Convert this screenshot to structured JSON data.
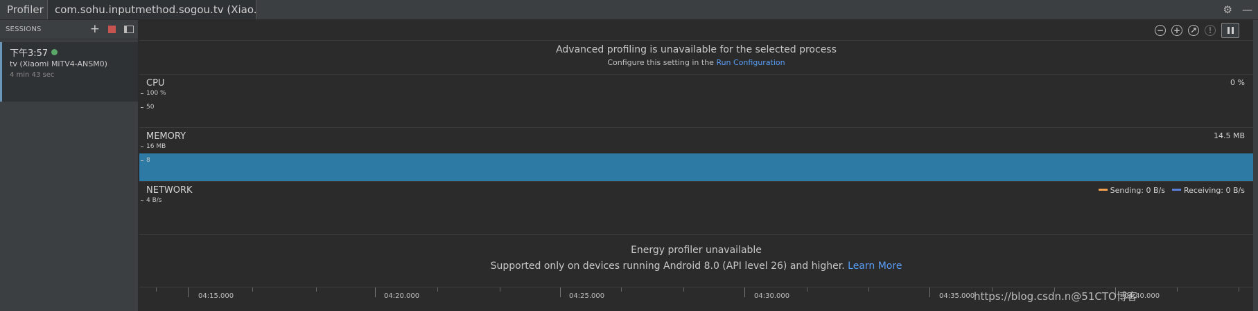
{
  "window": {
    "title": "Profiler",
    "process_tab": "com.sohu.inputmethod.sogou.tv (Xiao..."
  },
  "sidebar": {
    "sessions_label": "SESSIONS",
    "session": {
      "time": "下午3:57",
      "device": "tv (Xiaomi MiTV4-ANSM0)",
      "duration": "4 min 43 sec",
      "status_color": "#59a869"
    }
  },
  "notice": {
    "title": "Advanced profiling is unavailable for the selected process",
    "sub_prefix": "Configure this setting in the",
    "sub_link": "Run Configuration"
  },
  "cpu": {
    "title": "CPU",
    "value": "0 %",
    "ticks": [
      "100 %",
      "50"
    ]
  },
  "memory": {
    "title": "MEMORY",
    "value": "14.5 MB",
    "ticks": [
      "16 MB",
      "8"
    ],
    "fill_color": "#2d7aa4"
  },
  "network": {
    "title": "NETWORK",
    "tick": "4 B/s",
    "sending": "Sending: 0 B/s",
    "receiving": "Receiving: 0 B/s",
    "sending_color": "#f0a050",
    "receiving_color": "#5a7fd8"
  },
  "energy": {
    "title": "Energy profiler unavailable",
    "sub": "Supported only on devices running Android 8.0 (API level 26) and higher.",
    "link": "Learn More"
  },
  "timeline": {
    "labels": [
      "04:15.000",
      "04:20.000",
      "04:25.000",
      "04:30.000",
      "04:35.000",
      "04:40.000"
    ]
  },
  "watermark": "https://blog.csdn.n@51CTO博客",
  "icons": {
    "settings": "gear-icon",
    "minimize": "minimize-icon",
    "add_session": "plus-icon",
    "stop_session": "stop-icon",
    "collapse_panel": "panel-icon",
    "zoom_out": "zoom-out-icon",
    "zoom_in": "zoom-in-icon",
    "reset_zoom": "reset-zoom-icon",
    "go_live": "go-live-icon",
    "pause": "pause-icon"
  }
}
